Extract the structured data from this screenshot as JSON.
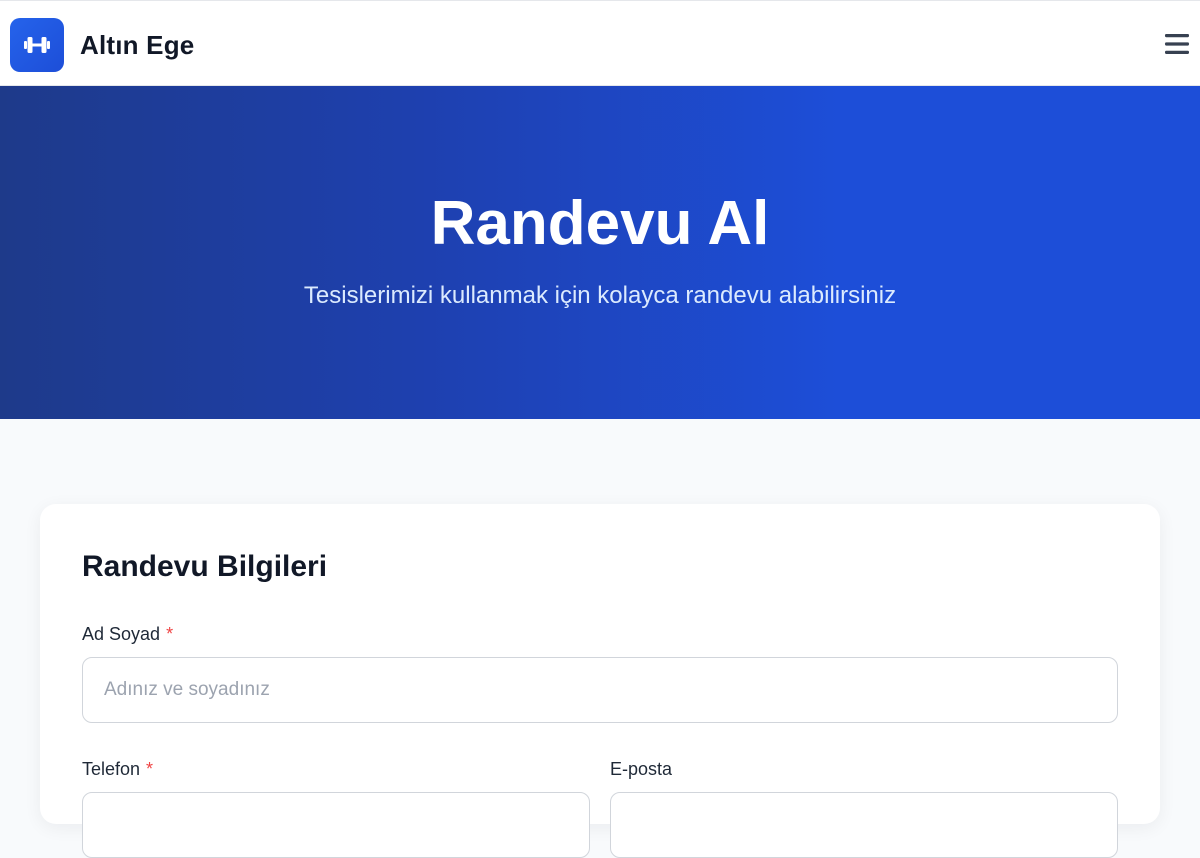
{
  "header": {
    "brand_name": "Altın Ege",
    "logo_icon": "dumbbell-icon",
    "menu_icon": "hamburger-menu-icon"
  },
  "hero": {
    "title": "Randevu Al",
    "subtitle": "Tesislerimizi kullanmak için kolayca randevu alabilirsiniz"
  },
  "form": {
    "title": "Randevu Bilgileri",
    "name": {
      "label": "Ad Soyad",
      "required_mark": "*",
      "placeholder": "Adınız ve soyadınız",
      "value": ""
    },
    "phone": {
      "label": "Telefon",
      "required_mark": "*",
      "placeholder": "",
      "value": ""
    },
    "email": {
      "label": "E-posta",
      "placeholder": "",
      "value": ""
    }
  },
  "colors": {
    "accent": "#1d4ed8",
    "hero_start": "#1e3a8a",
    "required": "#ef4444"
  }
}
